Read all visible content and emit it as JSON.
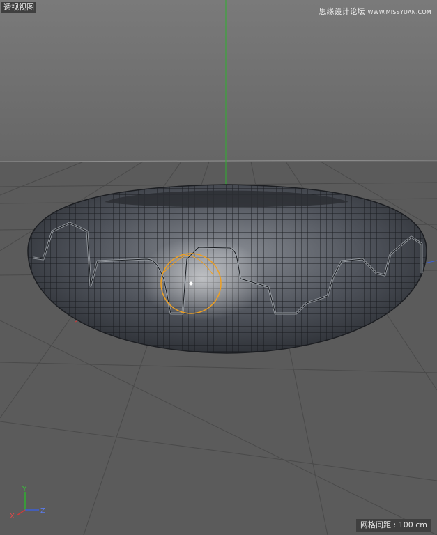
{
  "viewport": {
    "label": "透视视图",
    "grid_spacing_label": "网格间距 : 100 cm"
  },
  "watermark": {
    "brand": "思缘设计论坛",
    "site": "WWW.MISSYUAN.COM"
  },
  "axes": {
    "x": "X",
    "y": "Y",
    "z": "Z"
  },
  "colors": {
    "sky": "#6e6e6e",
    "floor": "#5b5b5b",
    "grid_line": "#464646",
    "horizon": "#8e8e8e",
    "y_axis": "#2fb02f",
    "x_axis": "#d23a3a",
    "z_axis": "#3c5fd6",
    "mesh_dark": "#1a1d21",
    "mesh_light": "#7b7f86",
    "selection": "#f0a020"
  }
}
